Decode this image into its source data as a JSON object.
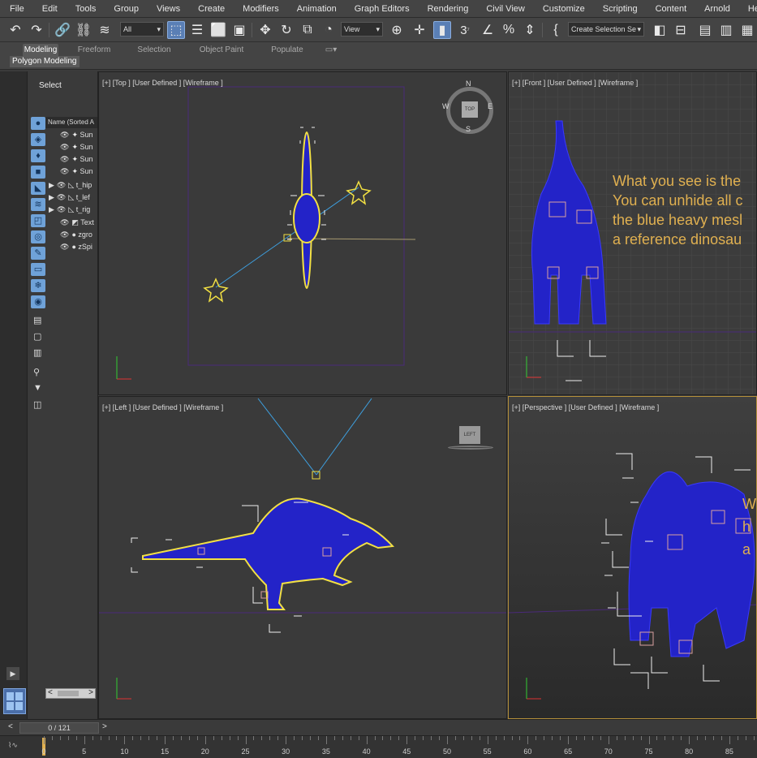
{
  "menu": [
    "File",
    "Edit",
    "Tools",
    "Group",
    "Views",
    "Create",
    "Modifiers",
    "Animation",
    "Graph Editors",
    "Rendering",
    "Civil View",
    "Customize",
    "Scripting",
    "Content",
    "Arnold",
    "Help"
  ],
  "toolbar": {
    "filter_value": "All",
    "view_value": "View",
    "selection_set_placeholder": "Create Selection Se",
    "snap_label": "3"
  },
  "ribbon": {
    "tabs": [
      "Modeling",
      "Freeform",
      "Selection",
      "Object Paint",
      "Populate"
    ],
    "active_tab": "Modeling",
    "subtab": "Polygon Modeling"
  },
  "explorer": {
    "title": "Select",
    "column_header": "Name (Sorted A",
    "rows": [
      "Sun",
      "Sun",
      "Sun",
      "Sun",
      "t_hip",
      "t_lef",
      "t_rig",
      "Text",
      "zgro",
      "zSpi"
    ],
    "scroll_left": "<",
    "scroll_right": ">"
  },
  "viewports": {
    "top": "[+] [Top ] [User Defined ] [Wireframe ]",
    "front": "[+] [Front ] [User Defined ] [Wireframe ]",
    "left": "[+] [Left ] [User Defined ] [Wireframe ]",
    "perspective": "[+] [Perspective ] [User Defined ] [Wireframe ]"
  },
  "viewcube": {
    "top_face": "TOP",
    "left_face": "LEFT",
    "compass": [
      "N",
      "E",
      "S",
      "W"
    ]
  },
  "overlay_text": [
    "What you see is the",
    "You can unhide all c",
    "the blue heavy mesl",
    "a reference dinosau"
  ],
  "persp_overlay_text": [
    "W",
    "h",
    "a"
  ],
  "timeline": {
    "frame_display": "0 / 121",
    "prev": "<",
    "next": ">",
    "ticks": [
      0,
      5,
      10,
      15,
      20,
      25,
      30,
      35,
      40,
      45,
      50,
      55,
      60,
      65,
      70,
      75,
      80,
      85
    ]
  },
  "colors": {
    "mesh_blue": "#2323c8",
    "selection_yellow": "#f2e043",
    "accent_blue": "#5a7fb5",
    "viewport_active_border": "#b48f3a",
    "overlay_text": "#e0b050"
  }
}
